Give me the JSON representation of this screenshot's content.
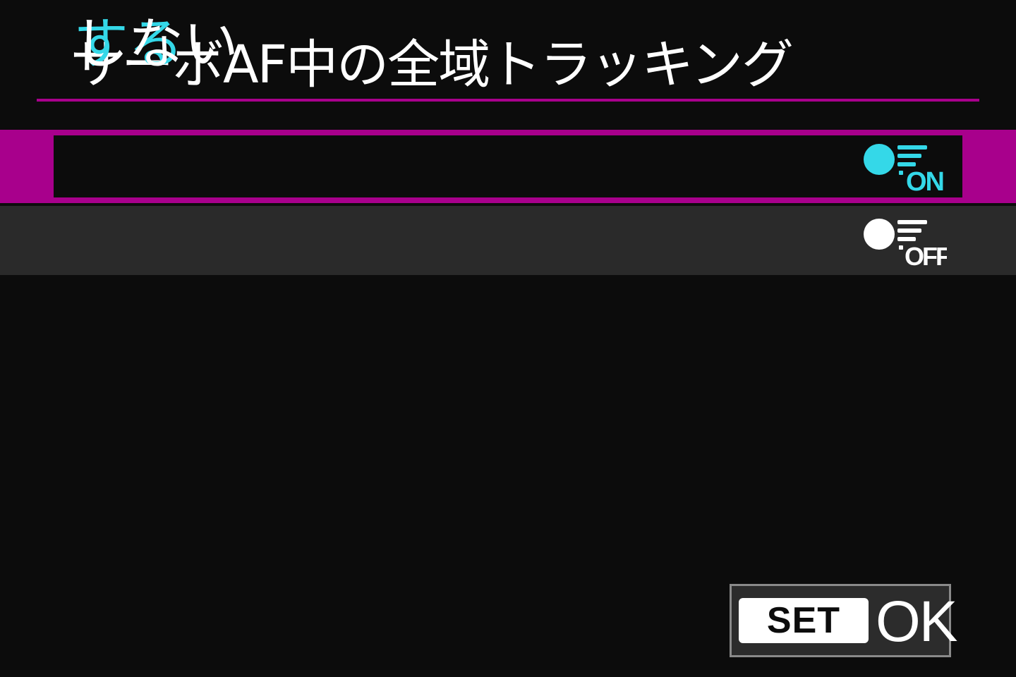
{
  "menu": {
    "title": "サーボAF中の全域トラッキング"
  },
  "options": [
    {
      "label": "する",
      "icon": "servo-af-tracking-on-icon",
      "icon_text": "ON",
      "selected": true
    },
    {
      "label": "しない",
      "icon": "servo-af-tracking-off-icon",
      "icon_text": "OFF",
      "selected": false
    }
  ],
  "footer": {
    "set_label": "SET",
    "ok_label": "OK"
  },
  "colors": {
    "background": "#0c0c0c",
    "accent": "#a8008c",
    "selected_text": "#34d8e8",
    "text": "#ffffff",
    "unselected_row": "#2a2a2a"
  }
}
